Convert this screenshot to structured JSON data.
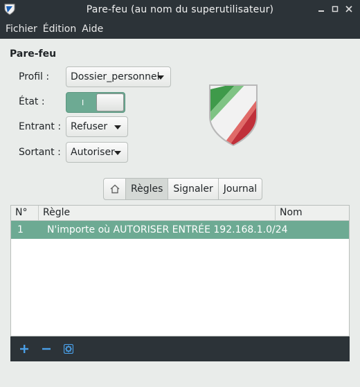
{
  "window": {
    "title": "Pare-feu (au nom du superutilisateur)",
    "controls": {
      "minimize": "minimize-icon",
      "maximize": "maximize-icon",
      "close": "close-icon"
    }
  },
  "menu": [
    "Fichier",
    "Édition",
    "Aide"
  ],
  "firewall": {
    "section_title": "Pare-feu",
    "profile": {
      "label": "Profil :",
      "value": "Dossier_personnel"
    },
    "status": {
      "label": "État :",
      "on_mark": "I"
    },
    "incoming": {
      "label": "Entrant :",
      "value": "Refuser"
    },
    "outgoing": {
      "label": "Sortant :",
      "value": "Autoriser"
    }
  },
  "tabs": [
    {
      "icon": "home-icon"
    },
    {
      "label": "Règles",
      "active": true
    },
    {
      "label": "Signaler"
    },
    {
      "label": "Journal"
    }
  ],
  "rules_table": {
    "columns": [
      "N°",
      "Règle",
      "Nom"
    ],
    "rows": [
      {
        "num": "1",
        "rule": "N'importe où AUTORISER ENTRÉE 192.168.1.0/24",
        "name": ""
      }
    ]
  },
  "toolbar": {
    "add": "+",
    "remove": "−",
    "settings_icon": "gear-icon"
  },
  "colors": {
    "header_bg": "#2c3338",
    "accent": "#6daa93",
    "toolbar_icon": "#4aa0e8"
  }
}
